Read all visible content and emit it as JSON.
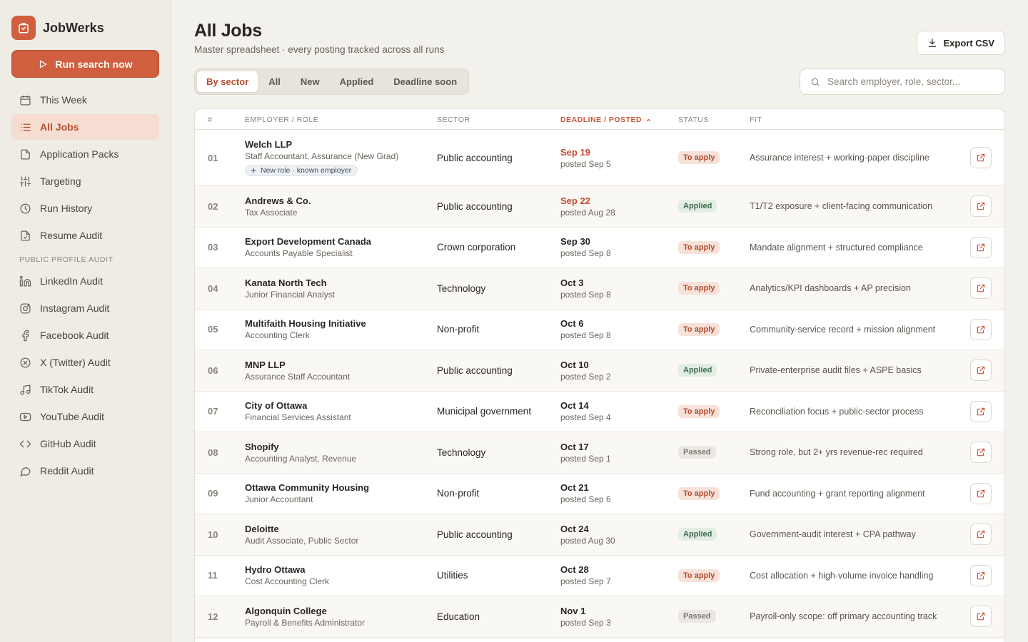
{
  "app": {
    "name": "JobWerks",
    "accent": "#cf5f3e"
  },
  "sidebar": {
    "run_label": "Run search now",
    "items": [
      {
        "label": "This Week",
        "icon": "calendar-icon"
      },
      {
        "label": "All Jobs",
        "icon": "list-icon",
        "active": true
      },
      {
        "label": "Application Packs",
        "icon": "file-icon"
      },
      {
        "label": "Targeting",
        "icon": "sliders-icon"
      },
      {
        "label": "Run History",
        "icon": "clock-icon"
      },
      {
        "label": "Resume Audit",
        "icon": "file-check-icon"
      }
    ],
    "section_label": "Public Profile Audit",
    "audit_items": [
      {
        "label": "LinkedIn Audit",
        "icon": "linkedin-icon"
      },
      {
        "label": "Instagram Audit",
        "icon": "instagram-icon"
      },
      {
        "label": "Facebook Audit",
        "icon": "facebook-icon"
      },
      {
        "label": "X (Twitter) Audit",
        "icon": "x-icon"
      },
      {
        "label": "TikTok Audit",
        "icon": "music-icon"
      },
      {
        "label": "YouTube Audit",
        "icon": "youtube-icon"
      },
      {
        "label": "GitHub Audit",
        "icon": "code-icon"
      },
      {
        "label": "Reddit Audit",
        "icon": "chat-bubble-icon"
      }
    ]
  },
  "header": {
    "title": "All Jobs",
    "subtitle": "Master spreadsheet · every posting tracked across all runs",
    "export_label": "Export CSV"
  },
  "tabs": [
    "By sector",
    "All",
    "New",
    "Applied",
    "Deadline soon"
  ],
  "search": {
    "placeholder": "Search employer, role, sector..."
  },
  "table": {
    "columns": {
      "num": "#",
      "employer": "Employer / Role",
      "sector": "Sector",
      "deadline": "Deadline / Posted",
      "status": "Status",
      "fit": "Fit"
    },
    "rows": [
      {
        "num": "01",
        "employer": "Welch LLP",
        "role": "Staff Accountant, Assurance (New Grad)",
        "tag": "New role · known employer",
        "sector": "Public accounting",
        "deadline": "Sep 19",
        "posted": "posted Sep 5",
        "urgent": true,
        "status": "To apply",
        "fit": "Assurance interest + working-paper discipline"
      },
      {
        "num": "02",
        "employer": "Andrews & Co.",
        "role": "Tax Associate",
        "sector": "Public accounting",
        "deadline": "Sep 22",
        "posted": "posted Aug 28",
        "urgent": true,
        "status": "Applied",
        "fit": "T1/T2 exposure + client-facing communication"
      },
      {
        "num": "03",
        "employer": "Export Development Canada",
        "role": "Accounts Payable Specialist",
        "sector": "Crown corporation",
        "deadline": "Sep 30",
        "posted": "posted Sep 8",
        "status": "To apply",
        "fit": "Mandate alignment + structured compliance"
      },
      {
        "num": "04",
        "employer": "Kanata North Tech",
        "role": "Junior Financial Analyst",
        "sector": "Technology",
        "deadline": "Oct 3",
        "posted": "posted Sep 8",
        "status": "To apply",
        "fit": "Analytics/KPI dashboards + AP precision"
      },
      {
        "num": "05",
        "employer": "Multifaith Housing Initiative",
        "role": "Accounting Clerk",
        "sector": "Non-profit",
        "deadline": "Oct 6",
        "posted": "posted Sep 8",
        "status": "To apply",
        "fit": "Community-service record + mission alignment"
      },
      {
        "num": "06",
        "employer": "MNP LLP",
        "role": "Assurance Staff Accountant",
        "sector": "Public accounting",
        "deadline": "Oct 10",
        "posted": "posted Sep 2",
        "status": "Applied",
        "fit": "Private-enterprise audit files + ASPE basics"
      },
      {
        "num": "07",
        "employer": "City of Ottawa",
        "role": "Financial Services Assistant",
        "sector": "Municipal government",
        "deadline": "Oct 14",
        "posted": "posted Sep 4",
        "status": "To apply",
        "fit": "Reconciliation focus + public-sector process"
      },
      {
        "num": "08",
        "employer": "Shopify",
        "role": "Accounting Analyst, Revenue",
        "sector": "Technology",
        "deadline": "Oct 17",
        "posted": "posted Sep 1",
        "status": "Passed",
        "fit": "Strong role, but 2+ yrs revenue-rec required"
      },
      {
        "num": "09",
        "employer": "Ottawa Community Housing",
        "role": "Junior Accountant",
        "sector": "Non-profit",
        "deadline": "Oct 21",
        "posted": "posted Sep 6",
        "status": "To apply",
        "fit": "Fund accounting + grant reporting alignment"
      },
      {
        "num": "10",
        "employer": "Deloitte",
        "role": "Audit Associate, Public Sector",
        "sector": "Public accounting",
        "deadline": "Oct 24",
        "posted": "posted Aug 30",
        "status": "Applied",
        "fit": "Government-audit interest + CPA pathway"
      },
      {
        "num": "11",
        "employer": "Hydro Ottawa",
        "role": "Cost Accounting Clerk",
        "sector": "Utilities",
        "deadline": "Oct 28",
        "posted": "posted Sep 7",
        "status": "To apply",
        "fit": "Cost allocation + high-volume invoice handling"
      },
      {
        "num": "12",
        "employer": "Algonquin College",
        "role": "Payroll & Benefits Administrator",
        "sector": "Education",
        "deadline": "Nov 1",
        "posted": "posted Sep 3",
        "status": "Passed",
        "fit": "Payroll-only scope: off primary accounting track"
      }
    ]
  }
}
